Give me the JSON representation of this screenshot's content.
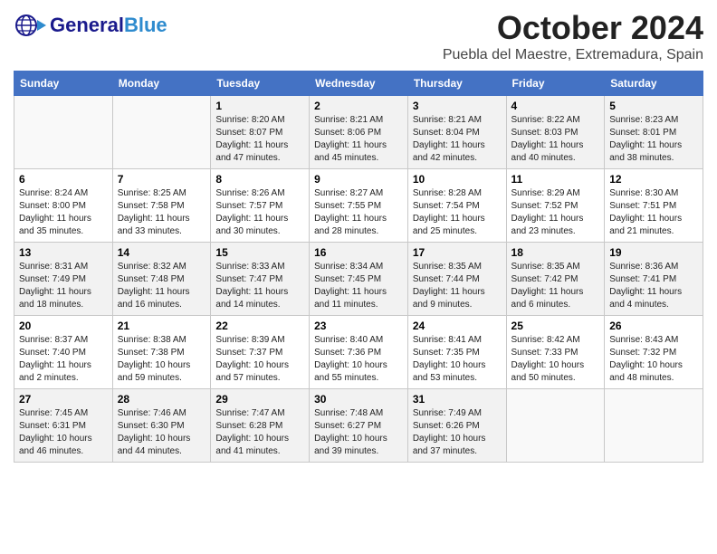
{
  "header": {
    "logo_general": "General",
    "logo_blue": "Blue",
    "month_year": "October 2024",
    "location": "Puebla del Maestre, Extremadura, Spain"
  },
  "weekdays": [
    "Sunday",
    "Monday",
    "Tuesday",
    "Wednesday",
    "Thursday",
    "Friday",
    "Saturday"
  ],
  "weeks": [
    [
      {
        "day": "",
        "info": ""
      },
      {
        "day": "",
        "info": ""
      },
      {
        "day": "1",
        "info": "Sunrise: 8:20 AM\nSunset: 8:07 PM\nDaylight: 11 hours and 47 minutes."
      },
      {
        "day": "2",
        "info": "Sunrise: 8:21 AM\nSunset: 8:06 PM\nDaylight: 11 hours and 45 minutes."
      },
      {
        "day": "3",
        "info": "Sunrise: 8:21 AM\nSunset: 8:04 PM\nDaylight: 11 hours and 42 minutes."
      },
      {
        "day": "4",
        "info": "Sunrise: 8:22 AM\nSunset: 8:03 PM\nDaylight: 11 hours and 40 minutes."
      },
      {
        "day": "5",
        "info": "Sunrise: 8:23 AM\nSunset: 8:01 PM\nDaylight: 11 hours and 38 minutes."
      }
    ],
    [
      {
        "day": "6",
        "info": "Sunrise: 8:24 AM\nSunset: 8:00 PM\nDaylight: 11 hours and 35 minutes."
      },
      {
        "day": "7",
        "info": "Sunrise: 8:25 AM\nSunset: 7:58 PM\nDaylight: 11 hours and 33 minutes."
      },
      {
        "day": "8",
        "info": "Sunrise: 8:26 AM\nSunset: 7:57 PM\nDaylight: 11 hours and 30 minutes."
      },
      {
        "day": "9",
        "info": "Sunrise: 8:27 AM\nSunset: 7:55 PM\nDaylight: 11 hours and 28 minutes."
      },
      {
        "day": "10",
        "info": "Sunrise: 8:28 AM\nSunset: 7:54 PM\nDaylight: 11 hours and 25 minutes."
      },
      {
        "day": "11",
        "info": "Sunrise: 8:29 AM\nSunset: 7:52 PM\nDaylight: 11 hours and 23 minutes."
      },
      {
        "day": "12",
        "info": "Sunrise: 8:30 AM\nSunset: 7:51 PM\nDaylight: 11 hours and 21 minutes."
      }
    ],
    [
      {
        "day": "13",
        "info": "Sunrise: 8:31 AM\nSunset: 7:49 PM\nDaylight: 11 hours and 18 minutes."
      },
      {
        "day": "14",
        "info": "Sunrise: 8:32 AM\nSunset: 7:48 PM\nDaylight: 11 hours and 16 minutes."
      },
      {
        "day": "15",
        "info": "Sunrise: 8:33 AM\nSunset: 7:47 PM\nDaylight: 11 hours and 14 minutes."
      },
      {
        "day": "16",
        "info": "Sunrise: 8:34 AM\nSunset: 7:45 PM\nDaylight: 11 hours and 11 minutes."
      },
      {
        "day": "17",
        "info": "Sunrise: 8:35 AM\nSunset: 7:44 PM\nDaylight: 11 hours and 9 minutes."
      },
      {
        "day": "18",
        "info": "Sunrise: 8:35 AM\nSunset: 7:42 PM\nDaylight: 11 hours and 6 minutes."
      },
      {
        "day": "19",
        "info": "Sunrise: 8:36 AM\nSunset: 7:41 PM\nDaylight: 11 hours and 4 minutes."
      }
    ],
    [
      {
        "day": "20",
        "info": "Sunrise: 8:37 AM\nSunset: 7:40 PM\nDaylight: 11 hours and 2 minutes."
      },
      {
        "day": "21",
        "info": "Sunrise: 8:38 AM\nSunset: 7:38 PM\nDaylight: 10 hours and 59 minutes."
      },
      {
        "day": "22",
        "info": "Sunrise: 8:39 AM\nSunset: 7:37 PM\nDaylight: 10 hours and 57 minutes."
      },
      {
        "day": "23",
        "info": "Sunrise: 8:40 AM\nSunset: 7:36 PM\nDaylight: 10 hours and 55 minutes."
      },
      {
        "day": "24",
        "info": "Sunrise: 8:41 AM\nSunset: 7:35 PM\nDaylight: 10 hours and 53 minutes."
      },
      {
        "day": "25",
        "info": "Sunrise: 8:42 AM\nSunset: 7:33 PM\nDaylight: 10 hours and 50 minutes."
      },
      {
        "day": "26",
        "info": "Sunrise: 8:43 AM\nSunset: 7:32 PM\nDaylight: 10 hours and 48 minutes."
      }
    ],
    [
      {
        "day": "27",
        "info": "Sunrise: 7:45 AM\nSunset: 6:31 PM\nDaylight: 10 hours and 46 minutes."
      },
      {
        "day": "28",
        "info": "Sunrise: 7:46 AM\nSunset: 6:30 PM\nDaylight: 10 hours and 44 minutes."
      },
      {
        "day": "29",
        "info": "Sunrise: 7:47 AM\nSunset: 6:28 PM\nDaylight: 10 hours and 41 minutes."
      },
      {
        "day": "30",
        "info": "Sunrise: 7:48 AM\nSunset: 6:27 PM\nDaylight: 10 hours and 39 minutes."
      },
      {
        "day": "31",
        "info": "Sunrise: 7:49 AM\nSunset: 6:26 PM\nDaylight: 10 hours and 37 minutes."
      },
      {
        "day": "",
        "info": ""
      },
      {
        "day": "",
        "info": ""
      }
    ]
  ]
}
